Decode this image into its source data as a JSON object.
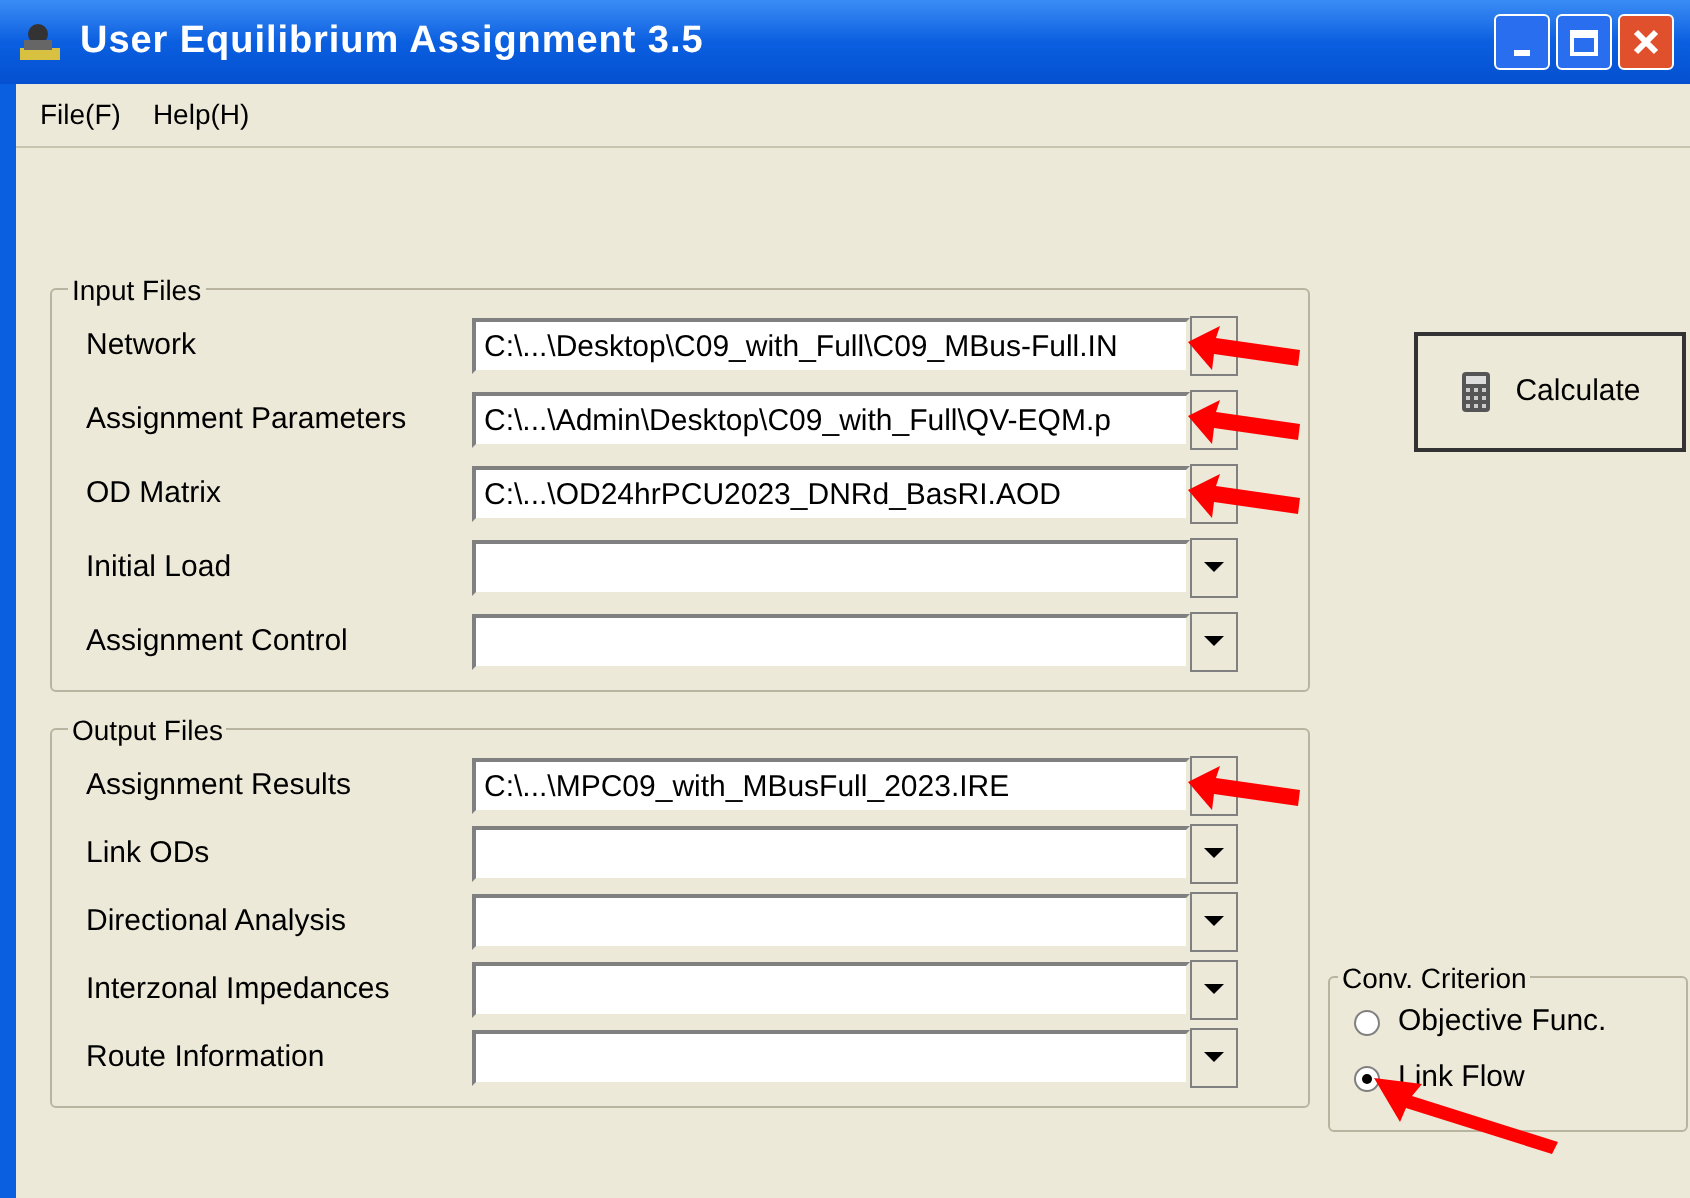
{
  "window": {
    "title": "User Equilibrium Assignment 3.5"
  },
  "menu": [
    "File(F)",
    "Help(H)"
  ],
  "input_files": {
    "title": "Input Files",
    "rows": [
      {
        "label": "Network",
        "value": "C:\\...\\Desktop\\C09_with_Full\\C09_MBus-Full.IN",
        "annotated": true
      },
      {
        "label": "Assignment Parameters",
        "value": "C:\\...\\Admin\\Desktop\\C09_with_Full\\QV-EQM.p",
        "annotated": true
      },
      {
        "label": "OD Matrix",
        "value": "C:\\...\\OD24hrPCU2023_DNRd_BasRI.AOD",
        "annotated": true
      },
      {
        "label": "Initial Load",
        "value": "",
        "annotated": false
      },
      {
        "label": "Assignment Control",
        "value": "",
        "annotated": false
      }
    ]
  },
  "output_files": {
    "title": "Output Files",
    "rows": [
      {
        "label": "Assignment Results",
        "value": "C:\\...\\MPC09_with_MBusFull_2023.IRE",
        "annotated": true
      },
      {
        "label": "Link ODs",
        "value": "",
        "annotated": false
      },
      {
        "label": "Directional Analysis",
        "value": "",
        "annotated": false
      },
      {
        "label": "Interzonal Impedances",
        "value": "",
        "annotated": false
      },
      {
        "label": "Route Information",
        "value": "",
        "annotated": false
      }
    ]
  },
  "calculate_button": "Calculate",
  "conv_criterion": {
    "title": "Conv. Criterion",
    "options": [
      {
        "label": "Objective Func.",
        "selected": false,
        "annotated": false
      },
      {
        "label": "Link Flow",
        "selected": true,
        "annotated": true
      }
    ]
  }
}
